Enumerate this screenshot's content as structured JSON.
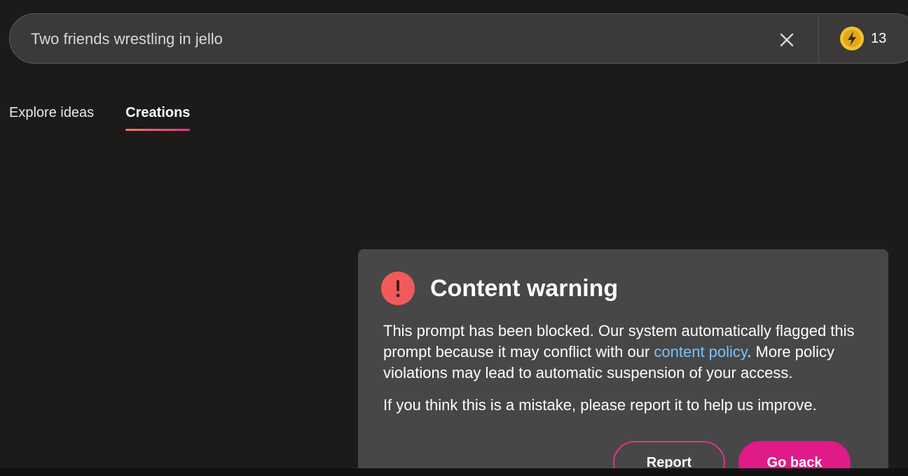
{
  "search": {
    "value": "Two friends wrestling in jello",
    "clear_icon": "close-icon"
  },
  "boosts": {
    "icon": "lightning-coin-icon",
    "count": "13"
  },
  "tabs": [
    {
      "label": "Explore ideas",
      "active": false
    },
    {
      "label": "Creations",
      "active": true
    }
  ],
  "dialog": {
    "icon": "exclamation-circle-icon",
    "title": "Content warning",
    "body_before_link": "This prompt has been blocked. Our system automatically flagged this prompt because it may conflict with our ",
    "link_text": "content policy",
    "body_after_link": ". More policy violations may lead to automatic suspension of your access.",
    "note": "If you think this is a mistake, please report it to help us improve.",
    "report_label": "Report",
    "back_label": "Go back"
  },
  "colors": {
    "background": "#1c1b1a",
    "accent_pink": "#e01a86",
    "warning_red": "#f05a5a",
    "link_blue": "#7cc0ff",
    "coin_yellow": "#f5c22b"
  }
}
